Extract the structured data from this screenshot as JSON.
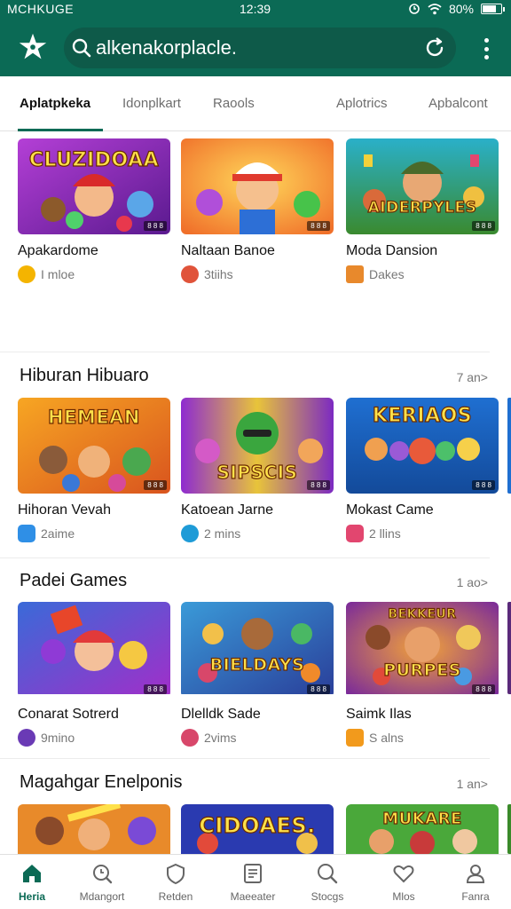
{
  "status_bar": {
    "carrier": "MCHKUGE",
    "time": "12:39",
    "battery": "80%",
    "battery_level": 0.8
  },
  "app_bar": {
    "search_value": "alkenakorplacle.",
    "logo_icon": "puzzle-star-icon",
    "reload_icon": "reload-icon",
    "menu_icon": "more-vert-icon"
  },
  "colors": {
    "primary": "#0b6a55",
    "search_bg": "#0e5a49",
    "accent": "#0b6a55"
  },
  "tabs": [
    {
      "label": "Aplatpkeka",
      "active": true
    },
    {
      "label": "Idonplkart"
    },
    {
      "label": "Raools"
    },
    {
      "label": "Aplotrics"
    },
    {
      "label": "Apbalcont"
    }
  ],
  "sections": [
    {
      "title": "",
      "more": "",
      "items": [
        {
          "thumb_text": "CLUZIDOAA",
          "badge": "8 8 8",
          "title": "Apakardome",
          "meta": "I mloe",
          "meta_icon": "clock-icon",
          "meta_color": "#f4b400"
        },
        {
          "thumb_text": "",
          "badge": "8 8 8",
          "title": "Naltaan Banoe",
          "meta": "3tiihs",
          "meta_icon": "flower-icon",
          "meta_color": "#e0533a"
        },
        {
          "thumb_text": "AIDERPYLES",
          "badge": "8 8 8",
          "title": "Moda Dansion",
          "meta": "Dakes",
          "meta_icon": "house-icon",
          "meta_color": "#e8892c"
        }
      ]
    },
    {
      "title": "Hiburan Hibuaro",
      "more": "7 an>",
      "items": [
        {
          "thumb_text": "HEMEAN",
          "badge": "8 8 8",
          "title": "Hihoran Vevah",
          "meta": "2aime",
          "meta_icon": "chat-icon",
          "meta_color": "#2f8fe6"
        },
        {
          "thumb_text": "SIPSCIS",
          "badge": "8 8 8",
          "title": "Katoean Jarne",
          "meta": "2 mins",
          "meta_icon": "compass-icon",
          "meta_color": "#1e9bd7"
        },
        {
          "thumb_text": "KERIAOS",
          "badge": "8 8 8",
          "title": "Mokast Came",
          "meta": "2 llins",
          "meta_icon": "gamepad-icon",
          "meta_color": "#e2466f"
        }
      ]
    },
    {
      "title": "Padei Games",
      "more": "1 ao>",
      "items": [
        {
          "thumb_text": "",
          "badge": "8 8 8",
          "title": "Conarat Sotrerd",
          "meta": "9mino",
          "meta_icon": "sparkle-icon",
          "meta_color": "#6a3ab5"
        },
        {
          "thumb_text": "BIELDAYS",
          "badge": "8 8 8",
          "title": "Dlelldk Sade",
          "meta": "2vims",
          "meta_icon": "puzzle-icon",
          "meta_color": "#d8476a"
        },
        {
          "thumb_text": "PURPES",
          "badge": "8 8 8",
          "title": "Saimk Ilas",
          "meta": "S alns",
          "meta_icon": "bag-icon",
          "meta_color": "#f29a1c"
        }
      ]
    },
    {
      "title": "Magahgar Enelponis",
      "more": "1 an>",
      "items": [
        {
          "thumb_text": "",
          "badge": "",
          "title": "",
          "meta": "",
          "meta_icon": "",
          "meta_color": ""
        },
        {
          "thumb_text": "CIDOAES.",
          "badge": "",
          "title": "",
          "meta": "",
          "meta_icon": "",
          "meta_color": ""
        },
        {
          "thumb_text": "MUKARE",
          "badge": "",
          "title": "",
          "meta": "",
          "meta_icon": "",
          "meta_color": ""
        }
      ]
    }
  ],
  "bottom_nav": [
    {
      "label": "Heria",
      "icon": "home-icon",
      "active": true
    },
    {
      "label": "Mdangort",
      "icon": "search-icon"
    },
    {
      "label": "Retden",
      "icon": "shield-icon"
    },
    {
      "label": "Maeeater",
      "icon": "document-icon"
    },
    {
      "label": "Stocgs",
      "icon": "search-icon"
    },
    {
      "label": "Mlos",
      "icon": "heart-icon"
    },
    {
      "label": "Fanra",
      "icon": "person-icon"
    }
  ]
}
